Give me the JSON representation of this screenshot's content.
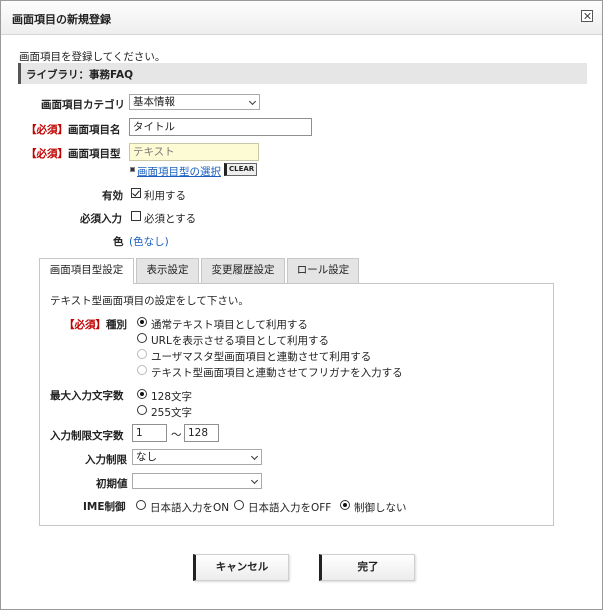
{
  "dialog": {
    "title": "画面項目の新規登録",
    "close_icon": "close-icon"
  },
  "intro_text": "画面項目を登録してください。",
  "library_label": "ライブラリ：事務FAQ",
  "form": {
    "category": {
      "label": "画面項目カテゴリ",
      "value": "基本情報"
    },
    "name": {
      "required_tag": "【必須】",
      "label": "画面項目名",
      "value": "タイトル"
    },
    "type": {
      "required_tag": "【必須】",
      "label": "画面項目型",
      "value": "テキスト",
      "select_link": "画面項目型の選択",
      "clear_label": "CLEAR"
    },
    "enabled": {
      "label": "有効",
      "option": "利用する",
      "checked": true
    },
    "required": {
      "label": "必須入力",
      "option": "必須とする",
      "checked": false
    },
    "color": {
      "label": "色",
      "value": "(色なし)"
    }
  },
  "tabs": [
    {
      "label": "画面項目型設定",
      "active": true
    },
    {
      "label": "表示設定",
      "active": false
    },
    {
      "label": "変更履歴設定",
      "active": false
    },
    {
      "label": "ロール設定",
      "active": false
    }
  ],
  "panel": {
    "description": "テキスト型画面項目の設定をして下さい。",
    "kind": {
      "required_tag": "【必須】",
      "label": "種別",
      "options": [
        {
          "label": "通常テキスト項目として利用する",
          "checked": true,
          "disabled": false
        },
        {
          "label": "URLを表示させる項目として利用する",
          "checked": false,
          "disabled": false
        },
        {
          "label": "ユーザマスタ型画面項目と連動させて利用する",
          "checked": false,
          "disabled": true
        },
        {
          "label": "テキスト型画面項目と連動させてフリガナを入力する",
          "checked": false,
          "disabled": true
        }
      ]
    },
    "max_length": {
      "label": "最大入力文字数",
      "options": [
        {
          "label": "128文字",
          "checked": true
        },
        {
          "label": "255文字",
          "checked": false
        }
      ]
    },
    "length_limit": {
      "label": "入力制限文字数",
      "min": "1",
      "separator": "～",
      "max": "128"
    },
    "input_limit": {
      "label": "入力制限",
      "value": "なし"
    },
    "initial_value": {
      "label": "初期値",
      "value": ""
    },
    "ime": {
      "label": "IME制御",
      "options": [
        {
          "label": "日本語入力をON",
          "checked": false
        },
        {
          "label": "日本語入力をOFF",
          "checked": false
        },
        {
          "label": "制御しない",
          "checked": true
        }
      ]
    }
  },
  "buttons": {
    "cancel": "キャンセル",
    "done": "完了"
  },
  "colors": {
    "required": "#c00000",
    "link": "#1a5fbf",
    "input_yellow": "#fdfbd4"
  }
}
